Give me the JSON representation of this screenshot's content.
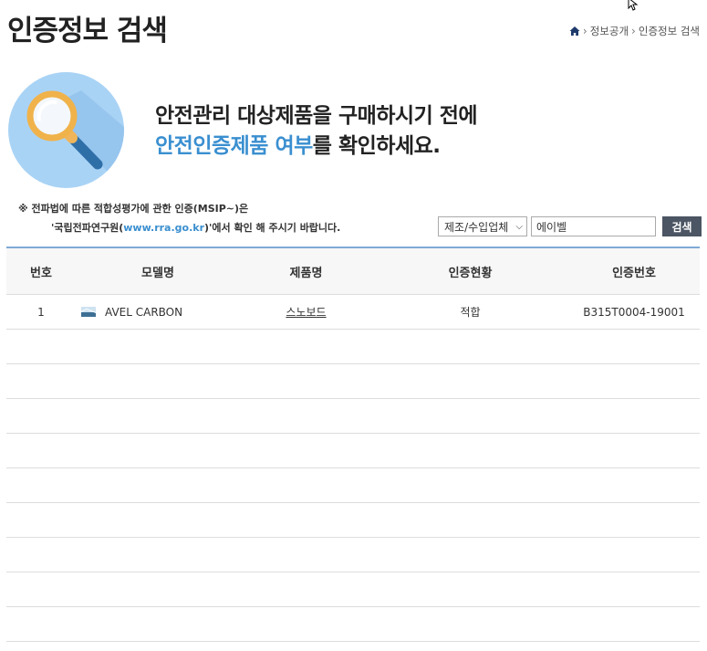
{
  "header": {
    "title": "인증정보 검색",
    "breadcrumb": [
      "정보공개",
      "인증정보 검색"
    ]
  },
  "hero": {
    "line1": "안전관리 대상제품을 구매하시기 전에",
    "line2_accent": "안전인증제품 여부",
    "line2_rest": "를 확인하세요."
  },
  "notice": {
    "line1": "※ 전파법에 따른 적합성평가에 관한 인증(MSIP~)은",
    "line2_prefix": "'국립전파연구원(",
    "line2_link": "www.rra.go.kr",
    "line2_suffix": ")'에서 확인 해 주시기 바랍니다."
  },
  "search": {
    "select_value": "제조/수입업체",
    "input_value": "에이벨",
    "button_label": "검색"
  },
  "table": {
    "headers": [
      "번호",
      "모델명",
      "제품명",
      "인증현황",
      "인증번호"
    ],
    "rows": [
      {
        "no": "1",
        "model": "AVEL CARBON",
        "product": "스노보드",
        "status": "적합",
        "cert": "B315T0004-19001"
      }
    ]
  },
  "colors": {
    "accent": "#3a8fd0",
    "table_top_border": "#7fa9d6",
    "search_button": "#4b5563"
  }
}
